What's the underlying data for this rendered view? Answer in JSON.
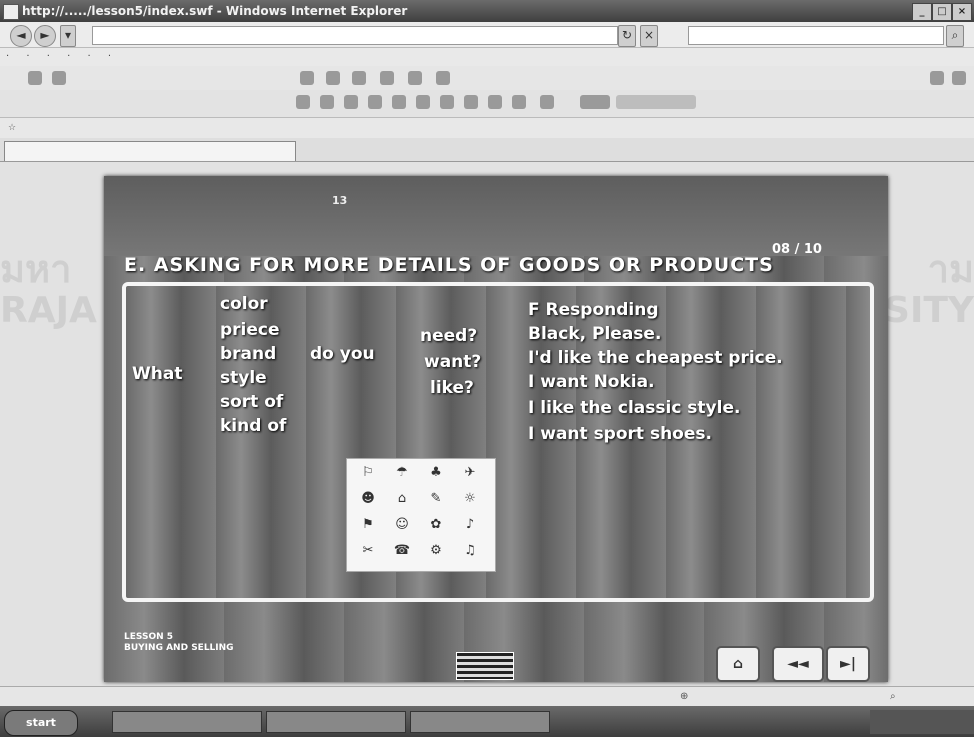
{
  "window": {
    "title": "http://...../lesson5/index.swf - Windows Internet Explorer"
  },
  "watermark": {
    "left_top": "มหา",
    "left_bottom": "RAJA",
    "right_top": "าม",
    "right_bottom": "SITY"
  },
  "slide": {
    "header_num": "13",
    "title": "E. ASKING FOR MORE DETAILS OF GOODS OR PRODUCTS",
    "page_counter": "08 / 10",
    "what": "What",
    "options": [
      "color",
      "priece",
      "brand",
      "style",
      "sort of",
      "kind of"
    ],
    "do_you": "do you",
    "verbs": [
      "need?",
      "want?",
      "like?"
    ],
    "responding_label": "F Responding",
    "responses": [
      "Black, Please.",
      "I'd like the cheapest price.",
      "I want Nokia.",
      "I like the classic style.",
      "I want sport shoes."
    ],
    "image_icons": [
      "⚐",
      "☂",
      "♣",
      "✈",
      "☻",
      "⌂",
      "✎",
      "☼",
      "⚑",
      "☺",
      "✿",
      "♪",
      "✂",
      "☎",
      "⚙",
      "♫"
    ],
    "footer_line1": "LESSON 5",
    "footer_line2": "BUYING AND SELLING",
    "buttons": {
      "home": "⌂",
      "back": "◄◄",
      "next": "►|"
    }
  },
  "taskbar": {
    "start": "start"
  }
}
